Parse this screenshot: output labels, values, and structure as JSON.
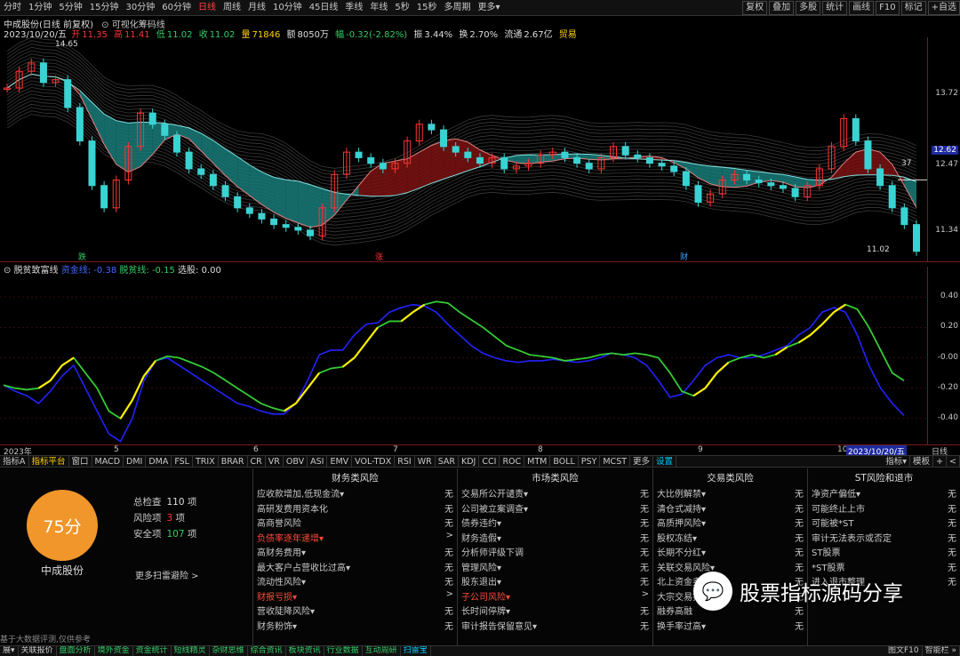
{
  "toolbar": {
    "periods": [
      "分时",
      "1分钟",
      "5分钟",
      "15分钟",
      "30分钟",
      "60分钟",
      "日线",
      "周线",
      "月线",
      "10分钟",
      "45日线",
      "季线",
      "年线",
      "5秒",
      "15秒",
      "多周期",
      "更多▾"
    ],
    "active_period": "日线",
    "right": [
      "复权",
      "叠加",
      "多股",
      "统计",
      "画线",
      "F10",
      "标记",
      "+自选"
    ]
  },
  "chart": {
    "title": "中成股份(日线 前复权)",
    "indicator_name": "可视化筹码线",
    "quote": {
      "date": "2023/10/20/五",
      "open_label": "开",
      "open": "11.35",
      "high_label": "高",
      "high": "11.41",
      "low_label": "低",
      "low": "11.02",
      "close_label": "收",
      "close": "11.02",
      "vol_label": "量",
      "vol": "71846",
      "amt_label": "额",
      "amt": "8050万",
      "chg_label": "幅",
      "chg": "-0.32(-2.82%)",
      "turn_label": "振",
      "turn": "3.44%",
      "swap_label": "换",
      "swap": "2.70%",
      "cap_label": "流通",
      "cap": "2.67亿",
      "trade_label": "贸易"
    },
    "peak_label": "14.65",
    "low_label": "11.02",
    "right_axis": [
      "13.72",
      "12.47",
      "11.34"
    ],
    "price_tag": "12.62",
    "line_tag": "37",
    "markers": [
      {
        "text": "跌",
        "color": "#33cc66"
      },
      {
        "text": "涨",
        "color": "#ff3333"
      },
      {
        "text": "财",
        "color": "#3aa0ff"
      }
    ]
  },
  "indicator": {
    "name": "脱贫致富线",
    "l1_label": "资金线",
    "l1_value": "-0.38",
    "l2_label": "脱贫线",
    "l2_value": "-0.15",
    "l3_label": "选股",
    "l3_value": "0.00",
    "axis": [
      "0.40",
      "0.20",
      "-0.00",
      "-0.20",
      "-0.40"
    ]
  },
  "date_axis": {
    "labels": [
      "2023年",
      "5",
      "6",
      "7",
      "8",
      "9",
      "10"
    ],
    "current": "2023/10/20/五",
    "right": "日线"
  },
  "ind_tabs": {
    "items": [
      "指标A",
      "指标平台",
      "窗口",
      "MACD",
      "DMI",
      "DMA",
      "FSL",
      "TRIX",
      "BRAR",
      "CR",
      "VR",
      "OBV",
      "ASI",
      "EMV",
      "VOL-TDX",
      "RSI",
      "WR",
      "SAR",
      "KDJ",
      "CCI",
      "ROC",
      "MTM",
      "BOLL",
      "PSY",
      "MCST",
      "更多",
      "设置"
    ],
    "active": "指标平台",
    "link": "设置",
    "right": [
      "指标▾",
      "模板",
      "+",
      "<"
    ]
  },
  "risk": {
    "score": "75分",
    "stock_name": "中成股份",
    "total_label": "总检查",
    "total_value": "110",
    "total_unit": "项",
    "risk_label": "风险项",
    "risk_value": "3",
    "risk_unit": "项",
    "safe_label": "安全项",
    "safe_value": "107",
    "safe_unit": "项",
    "more_scan": "更多扫雷避险 >",
    "disclaimer": "基于大数据评测,仅供参考",
    "columns": [
      {
        "title": "财务类风险",
        "items": [
          {
            "label": "应收款增加,低现金流▾",
            "status": "无",
            "warn": false
          },
          {
            "label": "高研发费用资本化",
            "status": "无",
            "warn": false
          },
          {
            "label": "高商誉风险",
            "status": "无",
            "warn": false
          },
          {
            "label": "负债率逐年递增▾",
            "status": ">",
            "warn": true
          },
          {
            "label": "高财务费用▾",
            "status": "无",
            "warn": false
          },
          {
            "label": "最大客户占营收比过高▾",
            "status": "无",
            "warn": false
          },
          {
            "label": "流动性风险▾",
            "status": "无",
            "warn": false
          },
          {
            "label": "财报亏损▾",
            "status": ">",
            "warn": true
          },
          {
            "label": "营收陡降风险▾",
            "status": "无",
            "warn": false
          },
          {
            "label": "财务粉饰▾",
            "status": "无",
            "warn": false
          }
        ]
      },
      {
        "title": "市场类风险",
        "items": [
          {
            "label": "交易所公开谴责▾",
            "status": "无",
            "warn": false
          },
          {
            "label": "公司被立案调查▾",
            "status": "无",
            "warn": false
          },
          {
            "label": "债券违约▾",
            "status": "无",
            "warn": false
          },
          {
            "label": "财务造假▾",
            "status": "无",
            "warn": false
          },
          {
            "label": "分析师评级下调",
            "status": "无",
            "warn": false
          },
          {
            "label": "管理风险▾",
            "status": "无",
            "warn": false
          },
          {
            "label": "股东退出▾",
            "status": "无",
            "warn": false
          },
          {
            "label": "子公司风险▾",
            "status": ">",
            "warn": true
          },
          {
            "label": "长时间停牌▾",
            "status": "无",
            "warn": false
          },
          {
            "label": "审计报告保留意见▾",
            "status": "无",
            "warn": false
          }
        ]
      },
      {
        "title": "交易类风险",
        "items": [
          {
            "label": "大比例解禁▾",
            "status": "无",
            "warn": false
          },
          {
            "label": "清仓式减持▾",
            "status": "无",
            "warn": false
          },
          {
            "label": "高质押风险▾",
            "status": "无",
            "warn": false
          },
          {
            "label": "股权冻结▾",
            "status": "无",
            "warn": false
          },
          {
            "label": "长期不分红▾",
            "status": "无",
            "warn": false
          },
          {
            "label": "关联交易风险▾",
            "status": "无",
            "warn": false
          },
          {
            "label": "北上资金卖出",
            "status": "无",
            "warn": false
          },
          {
            "label": "大宗交易折价",
            "status": "无",
            "warn": false
          },
          {
            "label": "融券高融",
            "status": "无",
            "warn": false
          },
          {
            "label": "换手率过高▾",
            "status": "无",
            "warn": false
          }
        ]
      },
      {
        "title": "ST风险和退市",
        "items": [
          {
            "label": "净资产偏低▾",
            "status": "无",
            "warn": false
          },
          {
            "label": "可能终止上市",
            "status": "无",
            "warn": false
          },
          {
            "label": "可能被*ST",
            "status": "无",
            "warn": false
          },
          {
            "label": "审计无法表示或否定",
            "status": "无",
            "warn": false
          },
          {
            "label": "ST股票",
            "status": "无",
            "warn": false
          },
          {
            "label": "*ST股票",
            "status": "无",
            "warn": false
          },
          {
            "label": "进入退市整理",
            "status": "无",
            "warn": false
          }
        ]
      }
    ]
  },
  "watermark": {
    "text": "股票指标源码分享",
    "icon": "wechat-icon"
  },
  "statusbar": {
    "items": [
      "展▾",
      "关联报价",
      "盘面分析",
      "境外资金",
      "资金统计",
      "短线精灵",
      "杂财思维",
      "综合资讯",
      "板块资讯",
      "行业数据",
      "互动周研",
      "扫雷宝"
    ],
    "right": [
      "图文F10",
      "智能栏 »"
    ]
  },
  "colors": {
    "up": "#ff3333",
    "down": "#3ad3d3",
    "accent": "#f0962a",
    "line_green": "#33cc33",
    "line_blue": "#2222ff",
    "line_yellow": "#ffee00"
  },
  "chart_data": {
    "type": "line",
    "price_close": [
      13.95,
      14.25,
      14.4,
      14.05,
      14.1,
      13.6,
      13.0,
      12.2,
      11.8,
      12.3,
      12.9,
      13.5,
      13.3,
      13.1,
      12.8,
      12.5,
      12.4,
      12.2,
      12.0,
      11.8,
      11.7,
      11.6,
      11.5,
      11.45,
      11.4,
      11.3,
      11.8,
      12.4,
      12.8,
      12.7,
      12.6,
      12.5,
      12.6,
      13.0,
      13.3,
      13.2,
      12.9,
      12.8,
      12.7,
      12.6,
      12.7,
      12.5,
      12.55,
      12.6,
      12.75,
      12.8,
      12.7,
      12.6,
      12.5,
      12.7,
      12.9,
      12.75,
      12.7,
      12.6,
      12.55,
      12.45,
      12.2,
      11.9,
      12.05,
      12.3,
      12.4,
      12.3,
      12.25,
      12.2,
      12.15,
      12.0,
      12.2,
      12.5,
      12.9,
      13.4,
      13.0,
      12.5,
      12.2,
      11.8,
      11.5,
      11.02
    ],
    "ylim": [
      11.0,
      14.7
    ],
    "ind_green": [
      -0.18,
      -0.2,
      -0.21,
      -0.2,
      -0.15,
      -0.05,
      0.0,
      -0.1,
      -0.2,
      -0.35,
      -0.4,
      -0.28,
      -0.12,
      -0.02,
      0.01,
      0.0,
      -0.03,
      -0.06,
      -0.1,
      -0.15,
      -0.2,
      -0.25,
      -0.3,
      -0.33,
      -0.35,
      -0.3,
      -0.2,
      -0.1,
      -0.07,
      -0.06,
      0.0,
      0.1,
      0.2,
      0.24,
      0.24,
      0.3,
      0.35,
      0.37,
      0.36,
      0.3,
      0.25,
      0.2,
      0.14,
      0.08,
      0.05,
      0.02,
      0.01,
      0.0,
      -0.02,
      -0.01,
      0.0,
      0.02,
      0.03,
      0.02,
      0.03,
      0.02,
      0.0,
      -0.1,
      -0.22,
      -0.25,
      -0.2,
      -0.1,
      -0.03,
      0.0,
      0.02,
      0.0,
      0.02,
      0.07,
      0.1,
      0.15,
      0.22,
      0.3,
      0.35,
      0.32,
      0.2,
      0.05,
      -0.1,
      -0.15
    ],
    "ind_blue": [
      -0.18,
      -0.22,
      -0.25,
      -0.3,
      -0.22,
      -0.12,
      -0.05,
      -0.2,
      -0.35,
      -0.5,
      -0.55,
      -0.4,
      -0.15,
      -0.02,
      0.0,
      -0.05,
      -0.1,
      -0.15,
      -0.2,
      -0.25,
      -0.3,
      -0.32,
      -0.35,
      -0.37,
      -0.37,
      -0.3,
      -0.15,
      0.02,
      0.05,
      0.05,
      0.15,
      0.22,
      0.23,
      0.3,
      0.33,
      0.35,
      0.34,
      0.3,
      0.22,
      0.15,
      0.08,
      0.03,
      0.0,
      -0.02,
      -0.03,
      -0.02,
      -0.02,
      -0.01,
      -0.02,
      -0.03,
      -0.02,
      0.0,
      0.03,
      0.02,
      0.0,
      -0.05,
      -0.15,
      -0.26,
      -0.24,
      -0.15,
      -0.05,
      0.0,
      0.02,
      0.0,
      0.0,
      0.02,
      0.05,
      0.08,
      0.15,
      0.2,
      0.3,
      0.33,
      0.3,
      0.15,
      -0.05,
      -0.2,
      -0.3,
      -0.38
    ],
    "ind_ylim": [
      -0.5,
      0.5
    ]
  }
}
